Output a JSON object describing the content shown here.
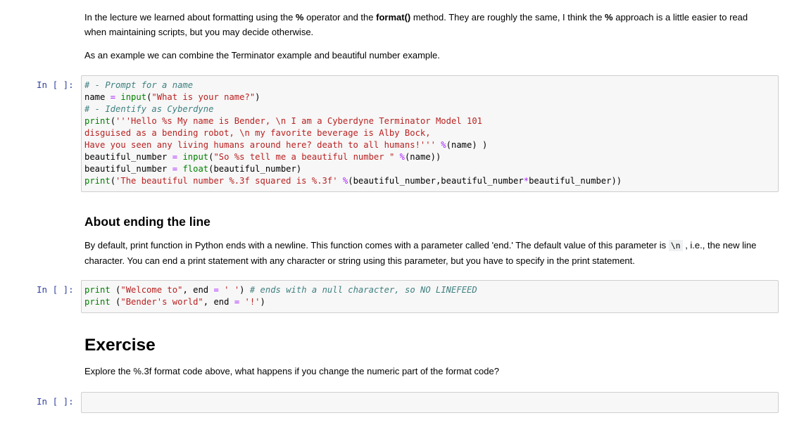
{
  "intro": {
    "p1_a": "In the lecture we learned about formatting using the ",
    "p1_op1": "%",
    "p1_b": " operator and the ",
    "p1_format": "format()",
    "p1_c": " method. They are roughly the same, I think the ",
    "p1_op2": "%",
    "p1_d": " approach is a little easier to read when maintaining scripts, but you may decide otherwise.",
    "p2": "As an example we can combine the Terminator example and beautiful number example."
  },
  "cells": {
    "prompt1": "In [ ]:",
    "prompt2": "In [ ]:",
    "prompt3": "In [ ]:"
  },
  "section1": {
    "heading": "About ending the line",
    "p_a": "By default, print function in Python ends with a newline. This function comes with a parameter called 'end.' The default value of this parameter is ",
    "p_code": "\\n",
    "p_b": " , i.e., the new line character. You can end a print statement with any character or string using this parameter, but you have to specify in the print statement."
  },
  "section2": {
    "heading": "Exercise",
    "p": "Explore the %.3f format code above, what happens if you change the numeric part of the format code?"
  },
  "code1": {
    "l1_cm": "# - Prompt for a name",
    "l2_a": "name ",
    "l2_op": "=",
    "l2_b": " ",
    "l2_kw": "input",
    "l2_c": "(",
    "l2_st": "\"What is your name?\"",
    "l2_d": ")",
    "l3_cm": "# - Identify as Cyberdyne",
    "l4_kw": "print",
    "l4_a": "(",
    "l4_st": "'''Hello %s My name is Bender, \\n I am a Cyberdyne Terminator Model 101",
    "l5_st": "disguised as a bending robot, \\n my favorite beverage is Alby Bock,",
    "l6_st": "Have you seen any living humans around here? death to all humans!'''",
    "l6_a": " ",
    "l6_op": "%",
    "l6_b": "(name) )",
    "l7_a": "beautiful_number ",
    "l7_op": "=",
    "l7_b": " ",
    "l7_kw": "input",
    "l7_c": "(",
    "l7_st": "\"So %s tell me a beautiful number \"",
    "l7_d": " ",
    "l7_op2": "%",
    "l7_e": "(name))",
    "l8_a": "beautiful_number ",
    "l8_op": "=",
    "l8_b": " ",
    "l8_kw": "float",
    "l8_c": "(beautiful_number)",
    "l9_kw": "print",
    "l9_a": "(",
    "l9_st": "'The beautiful number %.3f squared is %.3f'",
    "l9_b": " ",
    "l9_op": "%",
    "l9_c": "(beautiful_number,beautiful_number",
    "l9_op2": "*",
    "l9_d": "beautiful_number))"
  },
  "code2": {
    "l1_kw": "print",
    "l1_a": " (",
    "l1_st": "\"Welcome to\"",
    "l1_b": ", end ",
    "l1_op": "=",
    "l1_c": " ",
    "l1_st2": "' '",
    "l1_d": ") ",
    "l1_cm": "# ends with a null character, so NO LINEFEED",
    "l2_kw": "print",
    "l2_a": " (",
    "l2_st": "\"Bender's world\"",
    "l2_b": ", end ",
    "l2_op": "=",
    "l2_c": " ",
    "l2_st2": "'!'",
    "l2_d": ")"
  },
  "colors": {
    "prompt": "#303f9f",
    "comment": "#408080",
    "keyword": "#008000",
    "string": "#ba2121",
    "operator": "#aa22ff",
    "cell_bg": "#f7f7f7",
    "cell_border": "#cfcfcf"
  }
}
